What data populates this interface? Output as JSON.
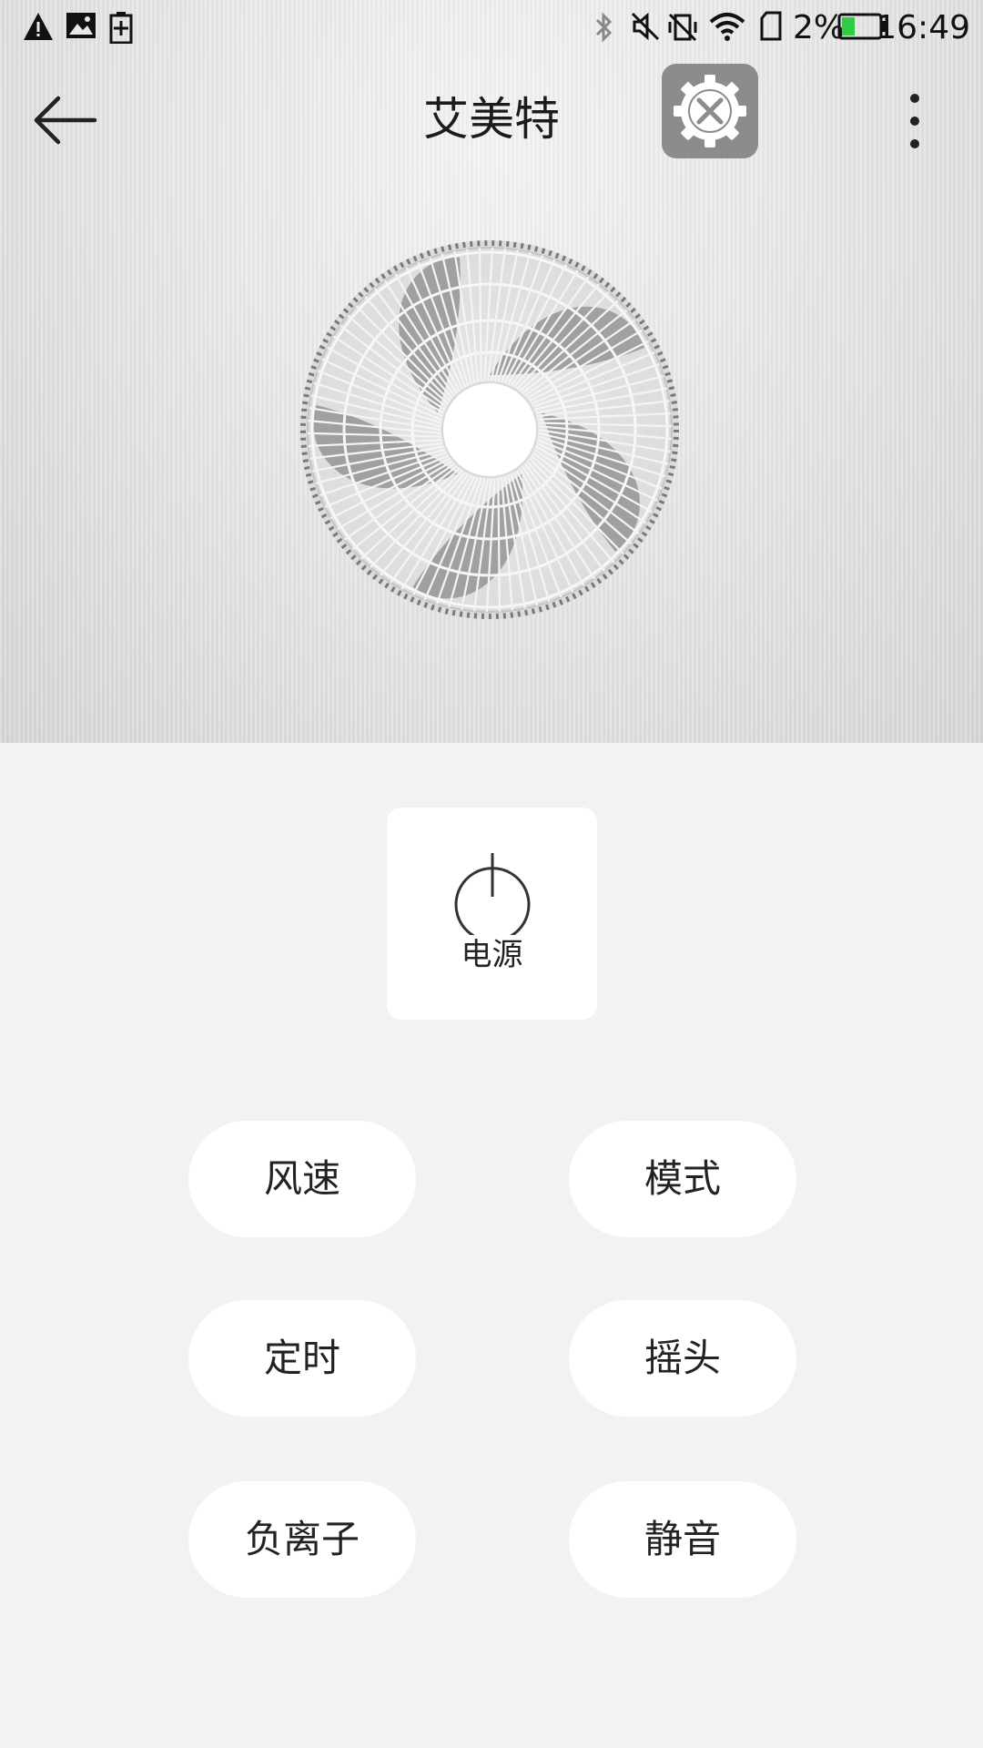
{
  "status_bar": {
    "time": "16:49",
    "battery_percent": "2%",
    "battery_level": 0.02,
    "battery_color": "#2ecc40",
    "icons": [
      "warning-icon",
      "image-icon",
      "battery-saver-icon",
      "bluetooth-icon",
      "mute-icon",
      "vibrate-off-icon",
      "wifi-icon",
      "sim-icon",
      "battery-icon"
    ]
  },
  "app_bar": {
    "title": "艾美特",
    "back_icon": "arrow-left-icon",
    "tool_icon": "settings-tools-icon",
    "more_icon": "more-vertical-icon"
  },
  "hero": {
    "image": "fan-illustration"
  },
  "controls": {
    "power_label": "电源",
    "buttons": [
      {
        "label": "风速"
      },
      {
        "label": "模式"
      },
      {
        "label": "定时"
      },
      {
        "label": "摇头"
      },
      {
        "label": "负离子"
      },
      {
        "label": "静音"
      }
    ]
  },
  "colors": {
    "background": "#f2f2f2",
    "card": "#ffffff",
    "tool_button": "#8c8c8c",
    "text": "#222222"
  }
}
